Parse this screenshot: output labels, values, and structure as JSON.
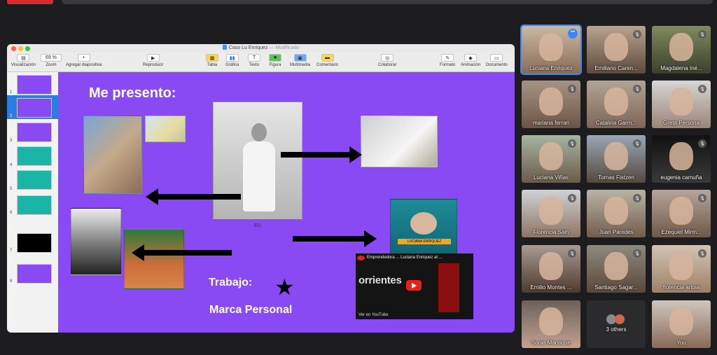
{
  "window": {
    "title": "Caso Lu Enriquez",
    "modified": "— Modificado"
  },
  "toolbar": {
    "visualizacion": "Visualización",
    "zoom_value": "69 %",
    "zoom": "Zoom",
    "add_slide": "Agregar diapositiva",
    "play": "Reproducir",
    "table": "Tabla",
    "chart": "Gráfica",
    "text": "Texto",
    "shape": "Figura",
    "media": "Multimedia",
    "comment": "Comentario",
    "collaborate": "Colaborar",
    "format": "Formato",
    "animation": "Animación",
    "document": "Documento"
  },
  "navigator": {
    "slides": [
      "1",
      "2",
      "3",
      "4",
      "5",
      "6",
      "7",
      "8"
    ]
  },
  "slide": {
    "title": "Me presento:",
    "photo_caption": "EU",
    "work": "Trabajo:",
    "brand": "Marca Personal",
    "video_title": "Emprendedora ... Luciana Enriquez at ...",
    "video_word": "orrientes",
    "video_footer": "Ver en YouTube",
    "poster_name": "LUCIANA ENRIQUEZ"
  },
  "participants": [
    {
      "name": "Luciana Enriquez",
      "muted": false,
      "active": true
    },
    {
      "name": "Emiliano Caren...",
      "muted": true
    },
    {
      "name": "Magdalena Iné...",
      "muted": true
    },
    {
      "name": "mariana ferrari",
      "muted": true
    },
    {
      "name": "Catalina Garm...",
      "muted": true
    },
    {
      "name": "Greta Persona",
      "muted": true
    },
    {
      "name": "Luciana Viñas",
      "muted": true
    },
    {
      "name": "Tomas Fistzen",
      "muted": true
    },
    {
      "name": "eugenia camuña",
      "muted": true
    },
    {
      "name": "Florencia Sain",
      "muted": true
    },
    {
      "name": "Juan Paredes",
      "muted": true
    },
    {
      "name": "Ezequiel Mirm...",
      "muted": true
    },
    {
      "name": "Emilio Montes ...",
      "muted": true
    },
    {
      "name": "Santiago Sagar...",
      "muted": true
    },
    {
      "name": "florencia artola",
      "muted": true
    },
    {
      "name": "Sonia Manrique",
      "muted": false
    },
    {
      "name": "3 others",
      "muted": false
    },
    {
      "name": "You",
      "muted": false
    }
  ]
}
